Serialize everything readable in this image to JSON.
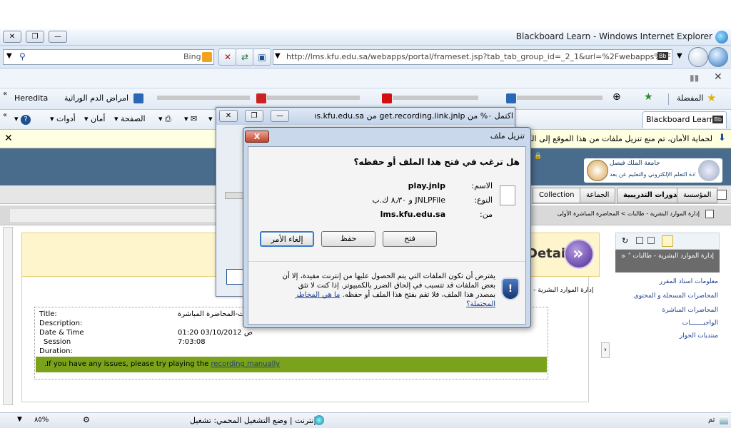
{
  "window": {
    "title": "Blackboard Learn - Windows Internet Explorer",
    "controls": [
      "×",
      "▭",
      "—"
    ]
  },
  "addressbar": {
    "search_provider": "Bing",
    "url": "http://lms.kfu.edu.sa/webapps/portal/frameset.jsp?tab_tab_group_id=_2_1&url=%2Fwebapps%2F",
    "url_badge": "Bb"
  },
  "favorites": {
    "label": "المفضلة",
    "item_hereditary": "Hereditа",
    "item_blood": "امراض الدم الوراثية"
  },
  "commandbar": {
    "tools": "أدوات",
    "safety": "أمان",
    "page": "الصفحة",
    "tab_title": "Blackboard Learn",
    "tab_badge": "Bb"
  },
  "infobar": {
    "text": "لحماية الأمان، تم منع تنزيل ملفات من هذا الموقع إلى الكمبيوتر"
  },
  "bb": {
    "logo_text_1": "جامعة الملك فيصل",
    "logo_text_2": "عمادة التعلم الإلكتروني والتعليم عن بعد",
    "tab_institution": "المؤسسة",
    "tab_courses": "الدورات التدريبية",
    "tab_community": "الجماعة",
    "tab_collection": "Collection",
    "breadcrumb": "إدارة الموارد البشرية - ظالبات > المحاضرة المباشرة الأولى",
    "breadcrumb_more": "إدارة الموارد ...",
    "details_title": "Details",
    "course_line": "إدارة الموارد البشرية - ظ",
    "info": {
      "title_label": "Title:",
      "title_value": "2 - طالبات-المحاضرة المباشرة",
      "description_label": "Description:",
      "date_label": "Date & Time",
      "date_value": "01:20 03/10/2012 ص",
      "session_label": "Session",
      "session_value": "7:03:08",
      "duration_label": "Duration:"
    },
    "issue_text": ".If you have any issues, please try playing the",
    "issue_link": "recording manually",
    "sidebar_head": "إدارة الموارد البشرية - طالبات",
    "sidebar_links": [
      "معلومات استاذ المقرر",
      "المحاضرات المسجلة و المحتوى",
      "المحاضرات المباشرة",
      "الواجبـــــــات",
      "منتديات الحوار"
    ]
  },
  "dialog_back": {
    "title": "اكتمل ٠% من get.recording.link.jnlp من lms.kfu.edu.sa"
  },
  "dialog": {
    "title": "تنزيل ملف",
    "question": "هل ترغب في فتح هذا الملف أو حفظه؟",
    "name_label": "الاسم:",
    "name_value": "play.jnlp",
    "type_label": "النوع:",
    "type_value": "JNLPFile و ٨٫٣٠ ك.ب",
    "from_label": "من:",
    "from_value": "lms.kfu.edu.sa",
    "open_button": "فتح",
    "save_button": "حفظ",
    "cancel_button": "إلغاء الأمر",
    "close_label": "X",
    "warning": "يفترض أن تكون الملفات التي يتم الحصول عليها من إنترنت مفيدة، إلا أن بعض الملفات قد تتسبب في إلحاق الضرر بالكمبيوتر. إذا كنت لا تثق بمصدر هذا الملف، فلا تقم بفتح هذا الملف أو حفظه.",
    "warning_link": "ما هي المخاطر المحتملة؟"
  },
  "statusbar": {
    "done": "تم",
    "zone": "إنترنت | وضع التشغيل المحمي: تشغيل",
    "zoom": "٨٥%"
  }
}
